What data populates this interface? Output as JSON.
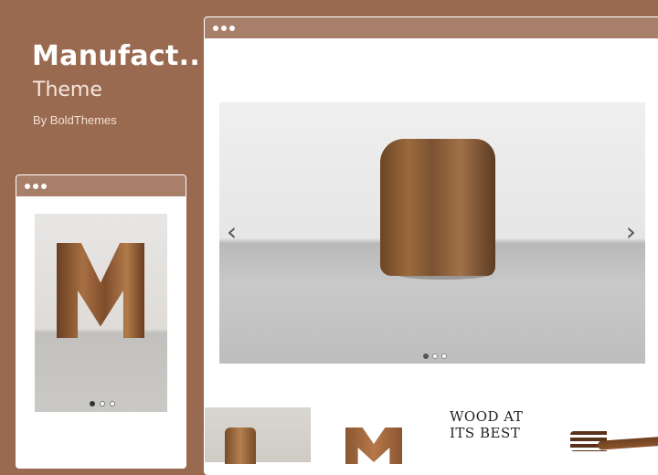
{
  "theme": {
    "title": "Manufact..",
    "subtitle": "Theme",
    "byline": "By BoldThemes"
  },
  "large_preview": {
    "slide_prev": "‹",
    "slide_next": "›",
    "slide_count": 3,
    "active_slide": 1,
    "tagline_line1": "WOOD AT",
    "tagline_line2": "ITS BEST"
  },
  "small_preview": {
    "slide_count": 3,
    "active_slide": 1
  },
  "colors": {
    "background": "#9a6a50",
    "browser_bar": "#a87f68",
    "window": "#ffffff"
  }
}
